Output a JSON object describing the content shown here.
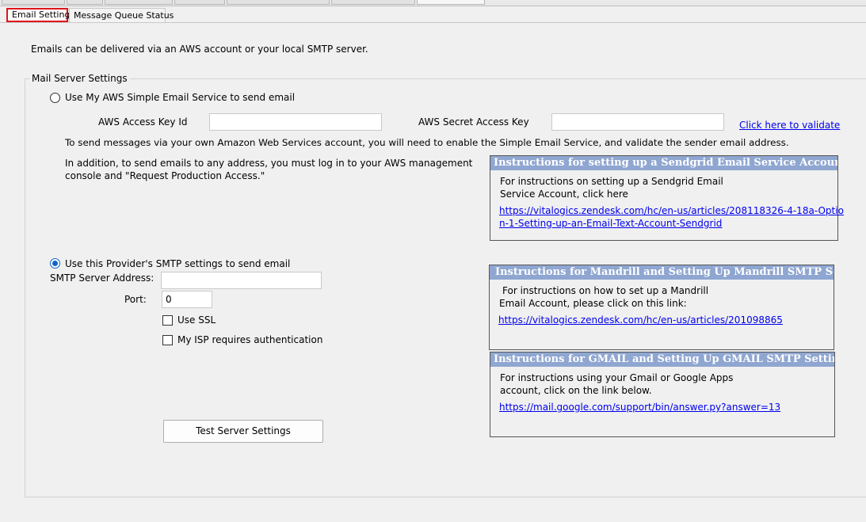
{
  "tabs": {
    "email_settings": "Email Settings",
    "message_queue": "Message Queue Status"
  },
  "intro": "Emails can be delivered via an AWS account or your local SMTP server.",
  "group_title": "Mail Server Settings",
  "aws": {
    "radio_label": "Use My AWS Simple Email Service to send email",
    "access_key_label": "AWS Access Key Id",
    "access_key_value": "",
    "secret_key_label": "AWS Secret Access Key",
    "secret_key_value": "",
    "validate_link": "Click here to validate",
    "note1": "To send messages via your own Amazon Web Services account, you will need to enable the Simple Email Service, and validate the sender email address.",
    "note2_line1": "In addition, to send emails to any address, you must log in to your AWS management",
    "note2_line2": "console and \"Request Production Access.\""
  },
  "smtp": {
    "radio_label": "Use this Provider's SMTP settings to send email",
    "server_label": "SMTP Server Address:",
    "server_value": "",
    "port_label": "Port:",
    "port_value": "0",
    "ssl_label": "Use SSL",
    "auth_label": "My ISP requires authentication",
    "test_button": "Test Server Settings"
  },
  "sendgrid": {
    "title": "Instructions for setting up a Sendgrid Email Service Account",
    "line1": "For instructions on setting up a Sendgrid Email",
    "line2": "Service Account, click here",
    "link_line1": "https://vitalogics.zendesk.com/hc/en-us/articles/208118326-4-18a-Optio",
    "link_line2": "n-1-Setting-up-an-Email-Text-Account-Sendgrid "
  },
  "mandrill": {
    "title": "Instructions for Mandrill and Setting Up Mandrill SMTP Settings",
    "line1": "For instructions on how to set up a Mandrill",
    "line2": "Email Account, please click on this link:",
    "link": "https://vitalogics.zendesk.com/hc/en-us/articles/201098865"
  },
  "gmail": {
    "title": "Instructions for GMAIL and Setting Up GMAIL SMTP Settings",
    "line1": "For instructions using your Gmail or Google Apps",
    "line2": "account, click on the link below.",
    "link": "https://mail.google.com/support/bin/answer.py?answer=13"
  }
}
